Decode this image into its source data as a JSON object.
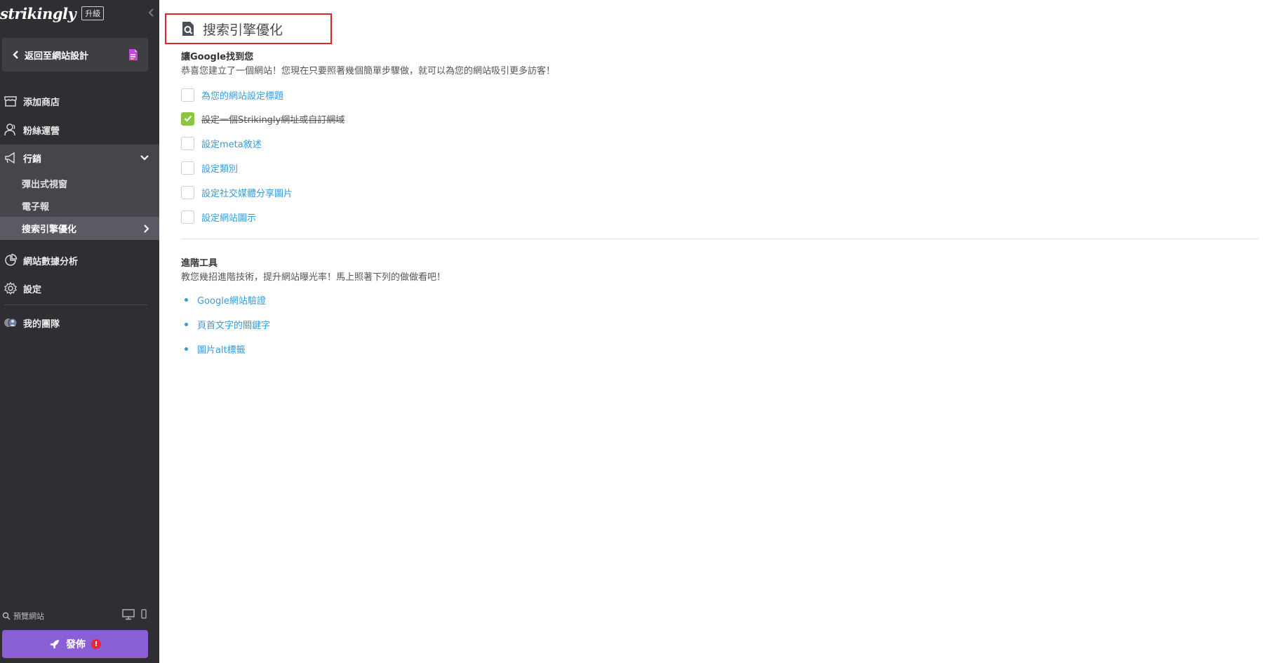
{
  "sidebar": {
    "brand": "strikingly",
    "upgrade_label": "升級",
    "back_label": "返回至網站設計",
    "items": [
      {
        "label": "添加商店",
        "icon": "store-icon"
      },
      {
        "label": "粉絲運營",
        "icon": "users-icon"
      },
      {
        "label": "網站數據分析",
        "icon": "pie-chart-icon"
      },
      {
        "label": "設定",
        "icon": "gear-icon"
      },
      {
        "label": "我的團隊",
        "icon": "team-avatar-icon"
      }
    ],
    "marketing": {
      "label": "行銷",
      "icon": "megaphone-icon",
      "sub_items": [
        "彈出式視窗",
        "電子報"
      ],
      "active_sub_item": "搜索引擎優化"
    },
    "preview_label": "預覽網站",
    "publish_label": "發佈",
    "publish_alert": "!"
  },
  "main": {
    "title": "搜索引擎優化",
    "google_section": {
      "title": "讓Google找到您",
      "desc": "恭喜您建立了一個網站！您現在只要照著幾個簡單步驟做，就可以為您的網站吸引更多訪客！",
      "checklist": [
        {
          "label": "為您的網站設定標題",
          "done": false
        },
        {
          "label": "設定一個Strikingly網址或自訂網域",
          "done": true
        },
        {
          "label": "設定meta敘述",
          "done": false
        },
        {
          "label": "設定類別",
          "done": false
        },
        {
          "label": "設定社交媒體分享圖片",
          "done": false
        },
        {
          "label": "設定網站圖示",
          "done": false
        }
      ]
    },
    "advanced_section": {
      "title": "進階工具",
      "desc": "教您幾招進階技術，提升網站曝光率！馬上照著下列的做做看吧！",
      "links": [
        "Google網站驗證",
        "頁首文字的關鍵字",
        "圖片alt標籤"
      ]
    }
  },
  "colors": {
    "sidebar_bg": "#2f2f33",
    "link": "#3a9bd5",
    "check_done": "#8cc63f",
    "publish": "#8a5fd6",
    "highlight_border": "#e0262a"
  }
}
